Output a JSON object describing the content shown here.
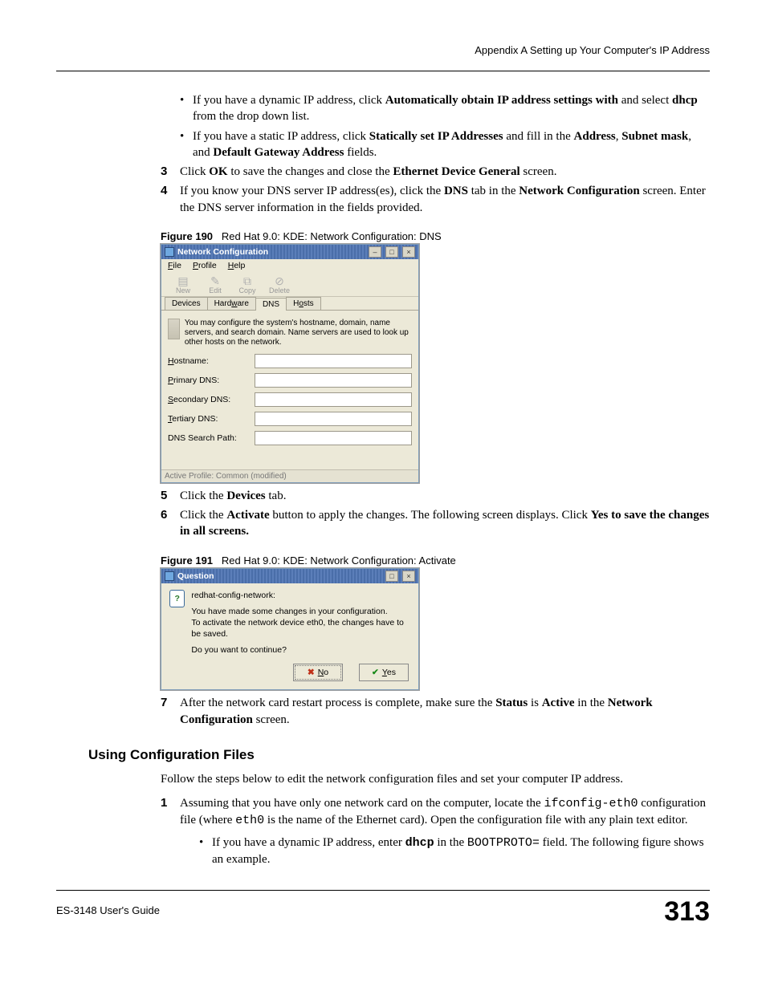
{
  "header": {
    "running": "Appendix A Setting up Your Computer's IP Address"
  },
  "steps_a": {
    "bullets": [
      {
        "pre": "If you have a dynamic IP address, click ",
        "b1": "Automatically obtain IP address settings with",
        "mid": " and select ",
        "b2": "dhcp",
        "post": " from the drop down list."
      },
      {
        "pre": "If you have a static IP address, click ",
        "b1": "Statically set IP Addresses",
        "mid": " and fill in the ",
        "b2": "Address",
        "mid2": ", ",
        "b3": "Subnet mask",
        "mid3": ", and ",
        "b4": "Default Gateway Address",
        "post": " fields."
      }
    ],
    "s3": {
      "num": "3",
      "pre": "Click ",
      "b1": "OK",
      "mid": " to save the changes and close the ",
      "b2": "Ethernet Device General",
      "post": " screen."
    },
    "s4": {
      "num": "4",
      "pre": "If you know your DNS server IP address(es), click the ",
      "b1": "DNS",
      "mid": " tab in the ",
      "b2": "Network Configuration",
      "post": " screen. Enter the DNS server information in the fields provided."
    }
  },
  "fig190": {
    "cap_label": "Figure 190",
    "cap_text": "Red Hat 9.0: KDE: Network Configuration: DNS",
    "title": "Network Configuration",
    "menu": {
      "file": "File",
      "profile": "Profile",
      "help": "Help"
    },
    "tb": {
      "new": "New",
      "edit": "Edit",
      "copy": "Copy",
      "delete": "Delete"
    },
    "tabs": {
      "devices": "Devices",
      "hardware": "Hardware",
      "dns": "DNS",
      "hosts": "Hosts"
    },
    "info": "You may configure the system's hostname, domain, name servers, and search domain. Name servers are used to look up other hosts on the network.",
    "labels": {
      "hostname": "Hostname:",
      "primary": "Primary DNS:",
      "secondary": "Secondary DNS:",
      "tertiary": "Tertiary DNS:",
      "search": "DNS Search Path:"
    },
    "status": "Active Profile: Common (modified)"
  },
  "steps_b": {
    "s5": {
      "num": "5",
      "pre": "Click the ",
      "b1": "Devices",
      "post": " tab."
    },
    "s6": {
      "num": "6",
      "pre": "Click the ",
      "b1": "Activate",
      "mid": " button to apply the changes. The following screen displays. Click ",
      "b2": "Yes to save the changes in all screens.",
      "post": ""
    }
  },
  "fig191": {
    "cap_label": "Figure 191",
    "cap_text": "Red Hat 9.0: KDE: Network Configuration: Activate",
    "title": "Question",
    "line1": "redhat-config-network:",
    "line2": "You have made some changes in your configuration.",
    "line3": "To activate the network device eth0, the changes have to be saved.",
    "line4": "Do you want to continue?",
    "btn_no": "No",
    "btn_yes": "Yes"
  },
  "steps_c": {
    "s7": {
      "num": "7",
      "pre": "After the network card restart process is complete, make sure the ",
      "b1": "Status",
      "mid": " is ",
      "b2": "Active",
      "mid2": " in the ",
      "b3": "Network Configuration",
      "post": " screen."
    }
  },
  "section": {
    "heading": "Using Configuration Files",
    "intro": "Follow the steps below to edit the network configuration files and set your computer IP address.",
    "s1": {
      "num": "1",
      "pre": "Assuming that you have only one network card on the computer, locate the ",
      "m1": "ifconfig-eth0",
      "mid": " configuration file (where ",
      "m2": "eth0",
      "mid2": " is the name of the Ethernet card). Open the configuration file with any plain text editor."
    },
    "bul1": {
      "pre": "If you have a dynamic IP address, enter ",
      "b1": "dhcp",
      "mid": " in the ",
      "m1": "BOOTPROTO=",
      "post": " field.  The following figure shows an example."
    }
  },
  "footer": {
    "left": "ES-3148 User's Guide",
    "page": "313"
  }
}
